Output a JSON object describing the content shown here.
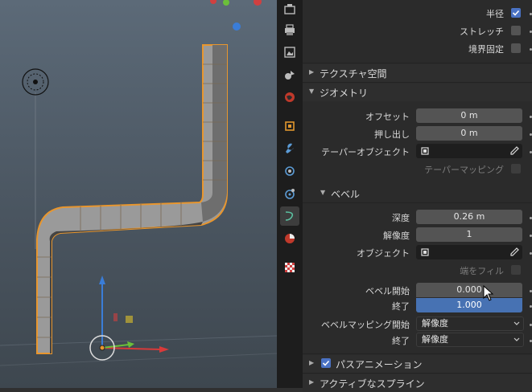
{
  "properties": {
    "radius_label": "半径",
    "stretch_label": "ストレッチ",
    "bounds_clamp_label": "境界固定",
    "texture_space_header": "テクスチャ空間",
    "geometry_header": "ジオメトリ",
    "offset_label": "オフセット",
    "offset_value": "0 m",
    "extrude_label": "押し出し",
    "extrude_value": "0 m",
    "taper_object_label": "テーパーオブジェクト",
    "taper_mapping_label": "テーパーマッピング",
    "bevel_header": "ベベル",
    "depth_label": "深度",
    "depth_value": "0.26 m",
    "resolution_label": "解像度",
    "resolution_value": "1",
    "object_label": "オブジェクト",
    "fill_caps_label": "端をフィル",
    "bevel_start_label": "ベベル開始",
    "bevel_start_value": "0.000",
    "bevel_end_label": "終了",
    "bevel_end_value": "1.000",
    "bevel_mapping_start_label": "ベベルマッピング開始",
    "bevel_mapping_start_value": "解像度",
    "bevel_mapping_end_label": "終了",
    "bevel_mapping_end_value": "解像度",
    "path_animation_header": "パスアニメーション",
    "active_spline_header": "アクティブなスプライン"
  },
  "colors": {
    "accent": "#4772b3",
    "curve_outline": "#e8962e",
    "axis_z": "#3a7dd8",
    "axis_x": "#d83a3a",
    "axis_y": "#6bbf3a"
  },
  "state": {
    "radius_checked": true,
    "stretch_checked": false,
    "bounds_clamp_checked": false,
    "path_animation_checked": true
  }
}
